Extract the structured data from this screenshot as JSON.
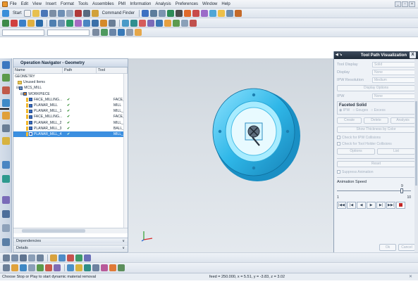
{
  "menubar": {
    "items": [
      "File",
      "Edit",
      "View",
      "Insert",
      "Format",
      "Tools",
      "Assemblies",
      "PMI",
      "Information",
      "Analysis",
      "Preferences",
      "Window",
      "Help"
    ],
    "window_buttons": [
      "_",
      "▫",
      "×"
    ]
  },
  "toolbar1": {
    "start_label": "Start",
    "command_finder_label": "Command Finder"
  },
  "navigator": {
    "title": "Operation Navigator - Geometry",
    "columns": [
      "Name",
      "Path",
      "Tool"
    ],
    "rows": [
      {
        "name": "GEOMETRY",
        "path": "",
        "tool": "",
        "selected": false
      },
      {
        "name": "Unused Items",
        "path": "",
        "tool": "",
        "selected": false
      },
      {
        "name": "MCS_MILL",
        "path": "",
        "tool": "",
        "selected": false
      },
      {
        "name": "WORKPIECE",
        "path": "",
        "tool": "",
        "selected": false
      },
      {
        "name": "FACE_MILLING...",
        "path": "✔",
        "tool": "FACE_",
        "selected": false
      },
      {
        "name": "PLANAR_MILL",
        "path": "✔",
        "tool": "MILL",
        "selected": false
      },
      {
        "name": "PLANAR_MILL_1",
        "path": "✔",
        "tool": "MILL_1",
        "selected": false
      },
      {
        "name": "FACE_MILLING...",
        "path": "✔",
        "tool": "FACE_",
        "selected": false
      },
      {
        "name": "PLANAR_MILL_2",
        "path": "✔",
        "tool": "MILL_1",
        "selected": false
      },
      {
        "name": "PLANAR_MILL_3",
        "path": "✔",
        "tool": "BALL_N",
        "selected": false
      },
      {
        "name": "PLANAR_MILL_4",
        "path": "✔",
        "tool": "MILL_4",
        "selected": true
      }
    ],
    "dependencies_label": "Dependencies",
    "details_label": "Details"
  },
  "dialog": {
    "title": "Tool Path Visualization",
    "close": "X",
    "tool_display_label": "Tool Display",
    "tool_display_value": "Solid",
    "display_label": "Display",
    "display_value": "None",
    "ipw_resolution_label": "IPW Resolution",
    "ipw_resolution_value": "Medium",
    "display_options_btn": "Display Options",
    "ipw_label": "IPW",
    "ipw_value": "None",
    "faceted_solid_label": "Faceted Solid",
    "radio_ipw": "IPW",
    "radio_gouges": "Gouges",
    "radio_excess": "Excess",
    "create_btn": "Create",
    "delete_btn": "Delete",
    "analysis_btn": "Analysis",
    "show_thickness_btn": "Show Thickness by Color",
    "check_ipw_collisions": "Check for IPW Collisions",
    "check_tool_holder": "Check for Tool Holder Collisions",
    "options_btn": "Options",
    "list_btn": "List",
    "reset_btn": "Reset",
    "suppress_animation": "Suppress Animation",
    "animation_speed_label": "Animation Speed",
    "speed_value": "9",
    "speed_min": "1",
    "speed_max": "10",
    "ok_btn": "Ok",
    "cancel_btn": "Cancel",
    "speed_fraction": 0.89
  },
  "status": {
    "message": "Choose Stop or Play to start dynamic material removal",
    "coords": "feed = 250.000, x = 5.51, y = -3.83, z = 3.02"
  },
  "colors": {
    "part_fill": "#2fb7e8",
    "part_light": "#8fe3ff",
    "selection": "#3b8fe0",
    "viewport_top": "#cfd6dd"
  }
}
